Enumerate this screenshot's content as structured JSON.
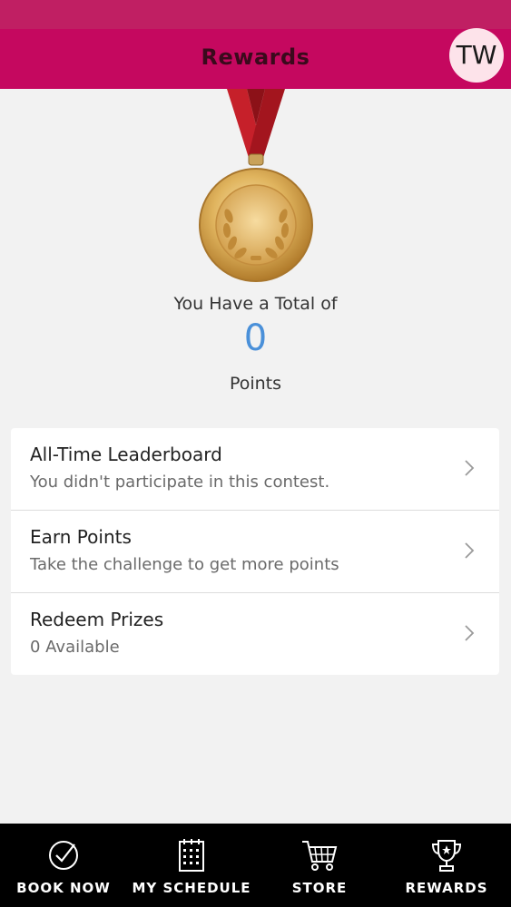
{
  "header": {
    "title": "Rewards",
    "avatar_initials": "TW"
  },
  "summary": {
    "total_label": "You Have a Total of",
    "points_value": "0",
    "points_label": "Points"
  },
  "menu": {
    "items": [
      {
        "title": "All-Time Leaderboard",
        "subtitle": "You didn't participate in this contest."
      },
      {
        "title": "Earn Points",
        "subtitle": "Take the challenge to get more points"
      },
      {
        "title": "Redeem Prizes",
        "subtitle": "0 Available"
      }
    ]
  },
  "tabbar": {
    "tabs": [
      {
        "label": "BOOK NOW",
        "icon": "check-circle-icon"
      },
      {
        "label": "MY SCHEDULE",
        "icon": "calendar-icon"
      },
      {
        "label": "STORE",
        "icon": "cart-icon"
      },
      {
        "label": "REWARDS",
        "icon": "trophy-icon"
      }
    ]
  },
  "colors": {
    "status_bar": "#c01f63",
    "header": "#c5085f",
    "points_accent": "#4a90d9",
    "background": "#f2f2f2",
    "tabbar": "#000000"
  }
}
